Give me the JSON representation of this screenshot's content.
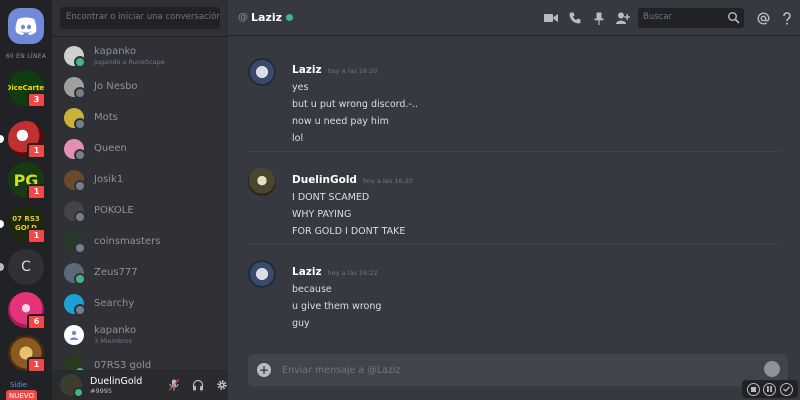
{
  "guild_rail": {
    "online_count": "60 EN LÍNEA",
    "guilds": [
      {
        "label": "DiceCartel",
        "badge": "3",
        "bg": "#0f3d0f",
        "fg": "#ffd700"
      },
      {
        "label": "",
        "badge": "1",
        "bg": "#7a1010",
        "fg": "#ffffff"
      },
      {
        "label": "PG",
        "badge": "1",
        "bg": "#173a12",
        "fg": "#ccdd33"
      },
      {
        "label": "07 RS3 GOLD",
        "badge": "1",
        "bg": "#1a2a0a",
        "fg": "#f0c040"
      },
      {
        "label": "C",
        "badge": "",
        "bg": "#2f3136",
        "fg": "#dcddde"
      },
      {
        "label": "",
        "badge": "6",
        "bg": "#e5337a",
        "fg": "#ffffff"
      },
      {
        "label": "",
        "badge": "1",
        "bg": "#8a5a20",
        "fg": "#ffffff"
      }
    ],
    "new_label": "NUEVO",
    "partial_label": "Sidie"
  },
  "dm_sidebar": {
    "search_placeholder": "Encontrar o iniciar una conversación",
    "items": [
      {
        "name": "kapanko",
        "subtitle": "Jugando a RuneScape",
        "status": "online",
        "avatar_color": "#d0d0d0"
      },
      {
        "name": "Jo Nesbo",
        "subtitle": "",
        "status": "offline",
        "avatar_color": "#a0a0a0"
      },
      {
        "name": "Mots",
        "subtitle": "",
        "status": "offline",
        "avatar_color": "#c9b13a"
      },
      {
        "name": "Queen",
        "subtitle": "",
        "status": "offline",
        "avatar_color": "#e78fb3"
      },
      {
        "name": "Josik1",
        "subtitle": "",
        "status": "offline",
        "avatar_color": "#6b4a2a"
      },
      {
        "name": "POKOLE",
        "subtitle": "",
        "status": "offline",
        "avatar_color": "#444444"
      },
      {
        "name": "coinsmasters",
        "subtitle": "",
        "status": "offline",
        "avatar_color": "#2a3a2a"
      },
      {
        "name": "Zeus777",
        "subtitle": "",
        "status": "online",
        "avatar_color": "#5a6a7a"
      },
      {
        "name": "Searchy",
        "subtitle": "",
        "status": "offline",
        "avatar_color": "#1ba1d8"
      },
      {
        "name": "kapanko",
        "subtitle": "3 Miembros",
        "status": "group",
        "avatar_color": "#ffffff"
      },
      {
        "name": "07RS3 gold",
        "subtitle": "",
        "status": "online",
        "avatar_color": "#2a3a1a"
      }
    ],
    "user": {
      "name": "DuelinGold",
      "tag": "#9995"
    }
  },
  "chat": {
    "channel_prefix": "@",
    "channel_name": "Laziz",
    "search_placeholder": "Buscar",
    "messages": [
      {
        "author": "Laziz",
        "time": "hoy a las 16:20",
        "lines": [
          "yes",
          "but u put wrong discord.-..",
          "now u need pay him",
          "lol"
        ]
      },
      {
        "author": "DuelinGold",
        "time": "hoy a las 16:20",
        "lines": [
          "I DONT SCAMED",
          "WHY PAYING",
          "FOR GOLD I DONT TAKE"
        ]
      },
      {
        "author": "Laziz",
        "time": "hoy a las 16:22",
        "lines": [
          "because",
          "u give them wrong",
          "guy",
          ".."
        ]
      }
    ],
    "composer_placeholder": "Enviar mensaje a @Laziz"
  },
  "colors": {
    "accent": "#7289da",
    "online": "#43b581",
    "offline": "#747f8d",
    "badge": "#f04747"
  }
}
